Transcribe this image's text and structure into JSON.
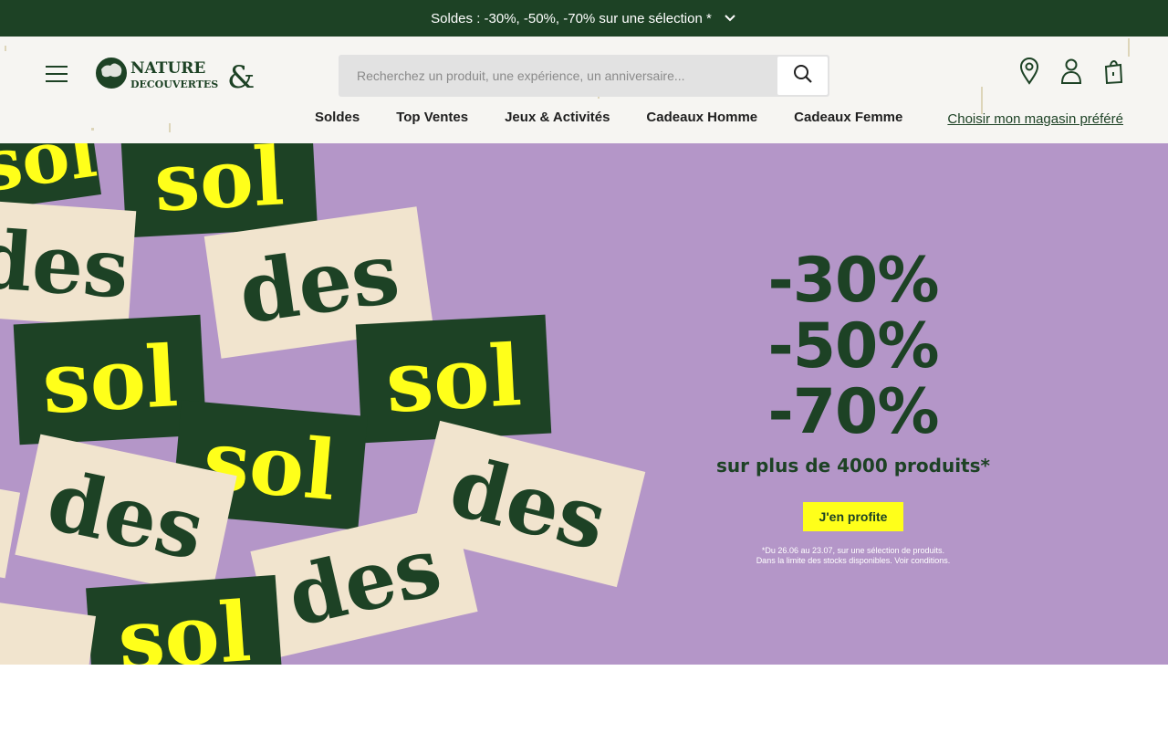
{
  "promo_bar": {
    "text": "Soldes : -30%, -50%, -70% sur une sélection *",
    "icon": "chevron-down-icon"
  },
  "header": {
    "logo_text_top": "NATURE",
    "logo_text_bottom": "DECOUVERTES",
    "logo_ampersand": "&",
    "search": {
      "placeholder": "Recherchez un produit, une expérience, un anniversaire..."
    },
    "nav": [
      "Soldes",
      "Top Ventes",
      "Jeux & Activités",
      "Cadeaux Homme",
      "Cadeaux Femme"
    ],
    "store_link": "Choisir mon magasin préféré",
    "icons": [
      "location-pin-icon",
      "account-icon",
      "shopping-bag-icon"
    ]
  },
  "hero": {
    "tiles": [
      "sol",
      "sol",
      "des",
      "des",
      "sol",
      "sol",
      "sol",
      "des",
      "des",
      "des",
      "sol"
    ],
    "discounts": [
      "-30%",
      "-50%",
      "-70%"
    ],
    "subtitle": "sur plus de 4000 produits*",
    "cta": "J'en profite",
    "fine_print_1": "*Du 26.06 au 23.07, sur une sélection de produits.",
    "fine_print_2": "Dans la limite des stocks disponibles. Voir conditions."
  },
  "colors": {
    "brand_green": "#1d4225",
    "hero_bg": "#b496c8",
    "accent_yellow": "#ffff1a",
    "cream": "#f1e4ce"
  }
}
